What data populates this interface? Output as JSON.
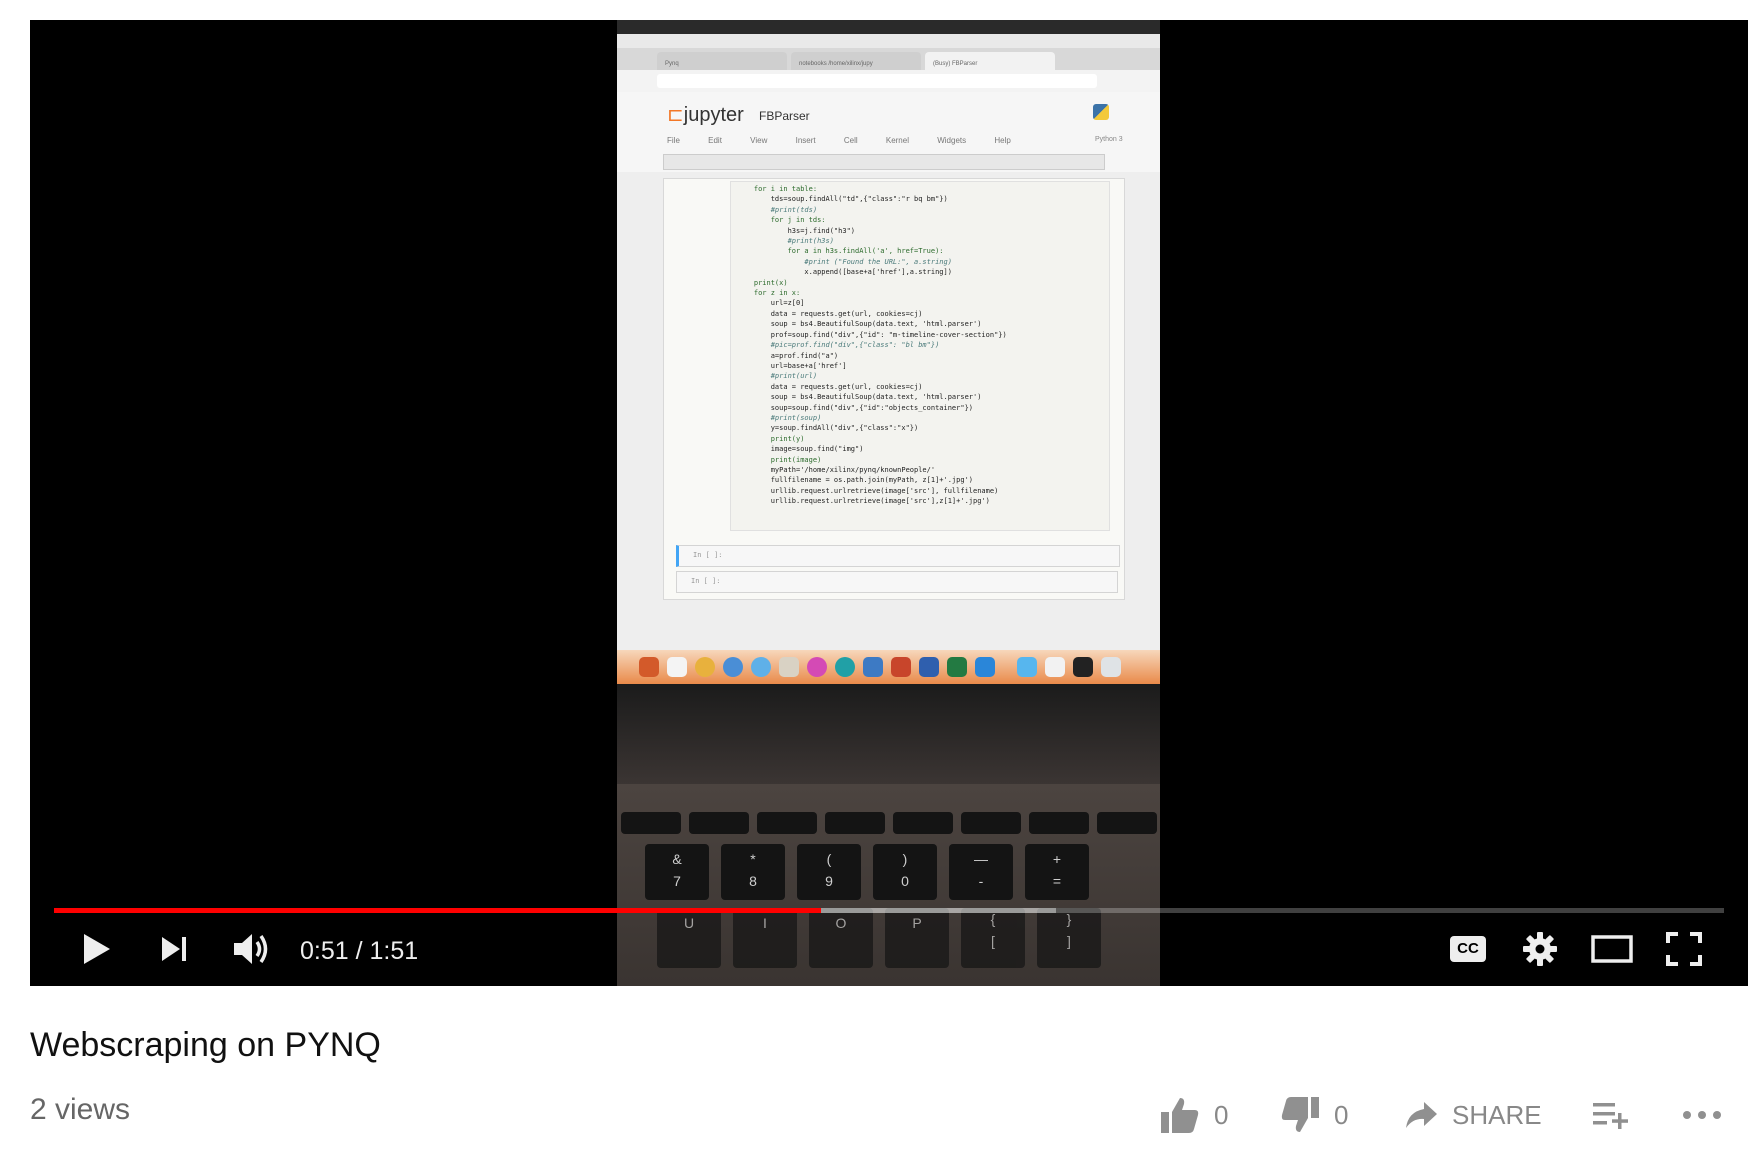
{
  "player": {
    "time_current": "0:51",
    "time_separator": "/",
    "time_total": "1:51",
    "progress_played": 0.4595,
    "progress_loaded": 0.6,
    "cc_label": "CC"
  },
  "video_content": {
    "browser_tabs": [
      "Pynq",
      "notebooks /home/xilinx/jupy",
      "(Busy) FBParser"
    ],
    "jupyter_logo": "jupyter",
    "notebook_name": "FBParser",
    "jupyter_menu": [
      "File",
      "Edit",
      "View",
      "Insert",
      "Cell",
      "Kernel",
      "Widgets",
      "Help"
    ],
    "kernel_label": "Python 3",
    "code_lines": [
      {
        "text": "    for i in table:",
        "kind": "kw"
      },
      {
        "text": "        tds=soup.findAll(\"td\",{\"class\":\"r bq bm\"})",
        "kind": "code"
      },
      {
        "text": "        #print(tds)",
        "kind": "comment"
      },
      {
        "text": "        for j in tds:",
        "kind": "kw"
      },
      {
        "text": "            h3s=j.find(\"h3\")",
        "kind": "code"
      },
      {
        "text": "            #print(h3s)",
        "kind": "comment"
      },
      {
        "text": "            for a in h3s.findAll('a', href=True):",
        "kind": "kw"
      },
      {
        "text": "                #print (\"Found the URL:\", a.string)",
        "kind": "comment"
      },
      {
        "text": "                x.append([base+a['href'],a.string])",
        "kind": "code"
      },
      {
        "text": "    print(x)",
        "kind": "kw"
      },
      {
        "text": "    for z in x:",
        "kind": "kw"
      },
      {
        "text": "        url=z[0]",
        "kind": "code"
      },
      {
        "text": "        data = requests.get(url, cookies=cj)",
        "kind": "code"
      },
      {
        "text": "        soup = bs4.BeautifulSoup(data.text, 'html.parser')",
        "kind": "code"
      },
      {
        "text": "        prof=soup.find(\"div\",{\"id\": \"m-timeline-cover-section\"})",
        "kind": "code"
      },
      {
        "text": "        #pic=prof.find(\"div\",{\"class\": \"bl bm\"})",
        "kind": "comment"
      },
      {
        "text": "        a=prof.find(\"a\")",
        "kind": "code"
      },
      {
        "text": "        url=base+a['href']",
        "kind": "code"
      },
      {
        "text": "        #print(url)",
        "kind": "comment"
      },
      {
        "text": "        data = requests.get(url, cookies=cj)",
        "kind": "code"
      },
      {
        "text": "        soup = bs4.BeautifulSoup(data.text, 'html.parser')",
        "kind": "code"
      },
      {
        "text": "        soup=soup.find(\"div\",{\"id\":\"objects_container\"})",
        "kind": "code"
      },
      {
        "text": "        #print(soup)",
        "kind": "comment"
      },
      {
        "text": "        y=soup.findAll(\"div\",{\"class\":\"x\"})",
        "kind": "code"
      },
      {
        "text": "        print(y)",
        "kind": "kw"
      },
      {
        "text": "        image=soup.find(\"img\")",
        "kind": "code"
      },
      {
        "text": "        print(image)",
        "kind": "kw"
      },
      {
        "text": "        myPath='/home/xilinx/pynq/knownPeople/'",
        "kind": "code"
      },
      {
        "text": "        fullfilename = os.path.join(myPath, z[1]+'.jpg')",
        "kind": "code"
      },
      {
        "text": "        urllib.request.urlretrieve(image['src'], fullfilename)",
        "kind": "code"
      },
      {
        "text": "        urllib.request.urlretrieve(image['src'],z[1]+'.jpg')",
        "kind": "code"
      }
    ],
    "empty_prompt": "In [ ]:",
    "keyboard_row1": [
      "&\n7",
      "*\n8",
      "(\n9",
      ")\n0",
      "—\n-",
      "+\n="
    ],
    "keyboard_row2": [
      "U",
      "I",
      "O",
      "P",
      "{\n[",
      "}\n]"
    ]
  },
  "video": {
    "title": "Webscraping on PYNQ",
    "views": "2 views"
  },
  "actions": {
    "like_count": "0",
    "dislike_count": "0",
    "share_label": "SHARE"
  },
  "icons": {
    "play": "play-icon",
    "next": "next-icon",
    "volume": "volume-icon",
    "cc": "cc-icon",
    "settings": "gear-icon",
    "theater": "theater-icon",
    "fullscreen": "fullscreen-icon",
    "like": "thumbs-up-icon",
    "dislike": "thumbs-down-icon",
    "share": "share-icon",
    "add_to": "add-to-playlist-icon",
    "more": "more-icon"
  },
  "colors": {
    "progress_played": "#ff0000",
    "player_bg": "#000000"
  }
}
